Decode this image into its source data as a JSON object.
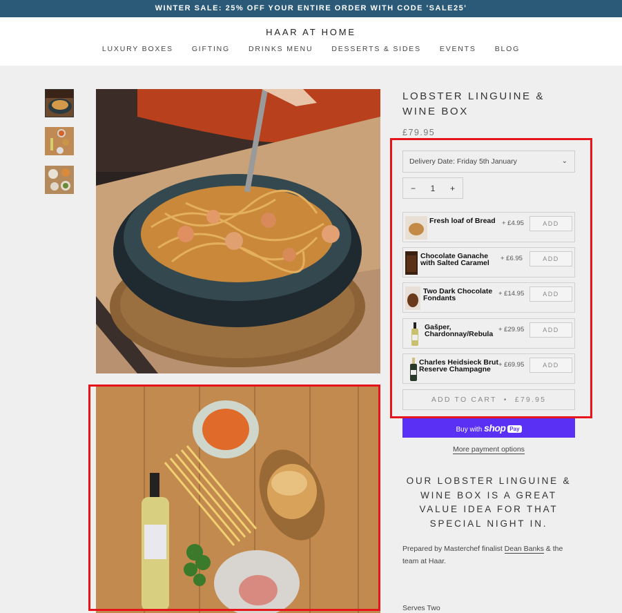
{
  "announcement": "WINTER SALE: 25% OFF YOUR ENTIRE ORDER WITH CODE 'SALE25'",
  "brand": "HAAR AT HOME",
  "nav": [
    "LUXURY BOXES",
    "GIFTING",
    "DRINKS MENU",
    "DESSERTS & SIDES",
    "EVENTS",
    "BLOG"
  ],
  "product": {
    "title": "LOBSTER LINGUINE & WINE BOX",
    "price": "£79.95",
    "delivery_select": "Delivery Date: Friday 5th January",
    "qty_minus": "−",
    "quantity": "1",
    "qty_plus": "+",
    "addons": [
      {
        "name": "Fresh loaf of Bread",
        "price": "+ £4.95",
        "button": "ADD"
      },
      {
        "name": "Chocolate Ganache with Salted Caramel",
        "price": "+ £6.95",
        "button": "ADD"
      },
      {
        "name": "Two Dark Chocolate Fondants",
        "price": "+ £14.95",
        "button": "ADD"
      },
      {
        "name": "Gašper, Chardonnay/Rebula",
        "price": "+ £29.95",
        "button": "ADD"
      },
      {
        "name": "Charles Heidsieck Brut Reserve Champagne",
        "price": "+ £69.95",
        "button": "ADD"
      }
    ],
    "add_to_cart": "ADD TO CART",
    "cart_separator": "•",
    "cart_price": "£79.95",
    "shoppay_prefix": "Buy with",
    "shoppay_brand": "shop",
    "shoppay_pay": "Pay",
    "more_payment": "More payment options",
    "promo": "OUR LOBSTER LINGUINE & WINE BOX IS A GREAT VALUE IDEA FOR THAT SPECIAL NIGHT IN.",
    "desc_before": "Prepared by Masterchef finalist ",
    "desc_link": "Dean Banks",
    "desc_after": " & the team at Haar.",
    "serves": "Serves Two"
  },
  "colors": {
    "announcement_bg": "#2a5a78",
    "shoppay": "#5a31f4",
    "highlight": "#e8141b"
  }
}
